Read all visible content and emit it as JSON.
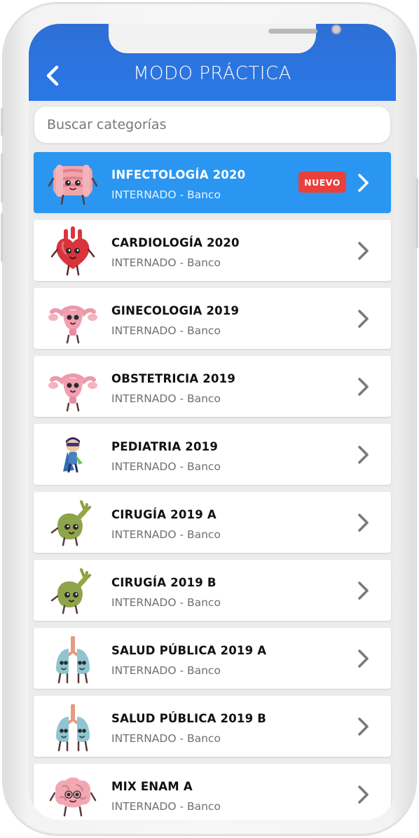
{
  "header": {
    "title": "MODO PRÁCTICA",
    "color": "#2a78e6"
  },
  "search": {
    "placeholder": "Buscar categorías",
    "value": ""
  },
  "categories": [
    {
      "name": "INFECTOLOGÍA 2020",
      "subtitle": "INTERNADO - Banco",
      "badge": "NUEVO",
      "icon": "intestine-icon",
      "active": true
    },
    {
      "name": "CARDIOLOGÍA 2020",
      "subtitle": "INTERNADO - Banco",
      "icon": "heart-icon"
    },
    {
      "name": "GINECOLOGIA 2019",
      "subtitle": "INTERNADO - Banco",
      "icon": "uterus-icon"
    },
    {
      "name": "OBSTETRICIA 2019",
      "subtitle": "INTERNADO - Banco",
      "icon": "uterus-icon"
    },
    {
      "name": "PEDIATRIA 2019",
      "subtitle": "INTERNADO - Banco",
      "icon": "superhero-kid-icon"
    },
    {
      "name": "CIRUGÍA 2019 A",
      "subtitle": "INTERNADO - Banco",
      "icon": "gallbladder-icon"
    },
    {
      "name": "CIRUGÍA 2019 B",
      "subtitle": "INTERNADO - Banco",
      "icon": "gallbladder-icon"
    },
    {
      "name": "SALUD PÚBLICA 2019 A",
      "subtitle": "INTERNADO - Banco",
      "icon": "lungs-icon"
    },
    {
      "name": "SALUD PÚBLICA 2019 B",
      "subtitle": "INTERNADO - Banco",
      "icon": "lungs-icon"
    },
    {
      "name": "MIX ENAM A",
      "subtitle": "INTERNADO - Banco",
      "icon": "brain-icon"
    }
  ]
}
